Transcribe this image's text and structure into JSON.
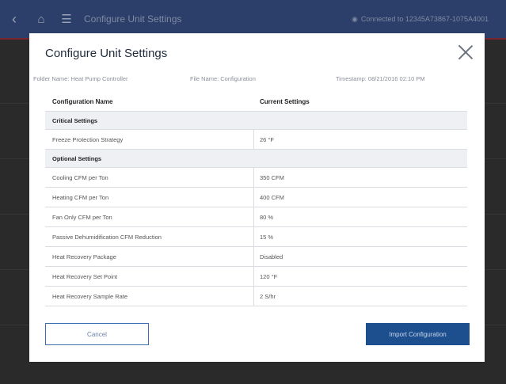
{
  "app": {
    "header_title": "Configure Unit Settings",
    "connection_text": "Connected to 12345A73867-1075A4001"
  },
  "modal": {
    "title": "Configure Unit Settings",
    "meta": {
      "folder_label": "Folder Name:",
      "folder_value": "Heat Pump Controller",
      "file_label": "File Name:",
      "file_value": "Configuration",
      "timestamp_label": "Timestamp:",
      "timestamp_value": "08/21/2016 02:10 PM"
    },
    "table": {
      "headers": [
        "Configuration Name",
        "Current Settings"
      ],
      "critical_section": "Critical Settings",
      "critical_rows": [
        {
          "name": "Freeze Protection Strategy",
          "value": "26 °F"
        }
      ],
      "optional_section": "Optional Settings",
      "optional_rows": [
        {
          "name": "Cooling CFM per Ton",
          "value": "350 CFM"
        },
        {
          "name": "Heating CFM per Ton",
          "value": "400 CFM"
        },
        {
          "name": "Fan Only CFM per Ton",
          "value": "80 %"
        },
        {
          "name": "Passive Dehumidification CFM Reduction",
          "value": "15 %"
        },
        {
          "name": "Heat Recovery Package",
          "value": "Disabled"
        },
        {
          "name": "Heat Recovery Set Point",
          "value": "120 °F"
        },
        {
          "name": "Heat Recovery Sample Rate",
          "value": "2 S/hr"
        }
      ]
    },
    "buttons": {
      "cancel": "Cancel",
      "import": "Import Configuration"
    }
  },
  "colors": {
    "header_bg": "#2c3f6b",
    "accent_blue": "#1d4f8f",
    "alert_red": "#7a2630"
  }
}
